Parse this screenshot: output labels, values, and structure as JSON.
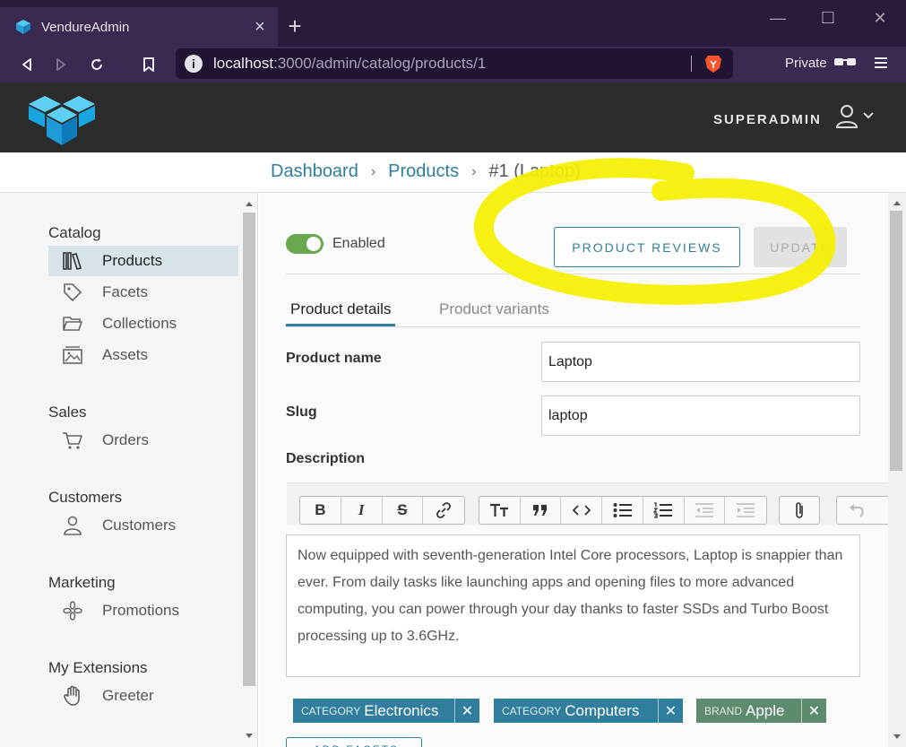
{
  "browser": {
    "tab_title": "VendureAdmin",
    "tab_close": "×",
    "new_tab": "+",
    "url_host": "localhost",
    "url_path": ":3000/admin/catalog/products/1",
    "info_glyph": "i",
    "private_label": "Private",
    "win_min": "—",
    "win_max": "☐",
    "win_close": "✕"
  },
  "header": {
    "user_label": "SUPERADMIN"
  },
  "breadcrumb": {
    "items": [
      "Dashboard",
      "Products",
      "#1 (Laptop)"
    ],
    "separator": "›"
  },
  "sidebar": {
    "sections": [
      {
        "title": "Catalog",
        "items": [
          "Products",
          "Facets",
          "Collections",
          "Assets"
        ]
      },
      {
        "title": "Sales",
        "items": [
          "Orders"
        ]
      },
      {
        "title": "Customers",
        "items": [
          "Customers"
        ]
      },
      {
        "title": "Marketing",
        "items": [
          "Promotions"
        ]
      },
      {
        "title": "My Extensions",
        "items": [
          "Greeter"
        ]
      }
    ]
  },
  "product": {
    "enabled_label": "Enabled",
    "reviews_button": "PRODUCT REVIEWS",
    "update_button": "UPDATE",
    "tabs": [
      "Product details",
      "Product variants"
    ],
    "name_label": "Product name",
    "name_value": "Laptop",
    "slug_label": "Slug",
    "slug_value": "laptop",
    "description_label": "Description",
    "description": "Now equipped with seventh-generation Intel Core processors, Laptop is snappier than ever. From daily tasks like launching apps and opening files to more advanced computing, you can power through your day thanks to faster SSDs and Turbo Boost processing up to 3.6GHz.",
    "facets": [
      {
        "key": "CATEGORY",
        "value": "Electronics",
        "color": "#2f7e9e"
      },
      {
        "key": "CATEGORY",
        "value": "Computers",
        "color": "#2f7e9e"
      },
      {
        "key": "BRAND",
        "value": "Apple",
        "color": "#5e8a6e"
      }
    ],
    "facet_remove": "✕",
    "add_facets_button": "+ ADD FACETS"
  },
  "colors": {
    "accent": "#2f7e9e",
    "header_bg": "#2c2c2c",
    "toggle_on": "#6aa84f",
    "annotation": "#f5f000"
  }
}
